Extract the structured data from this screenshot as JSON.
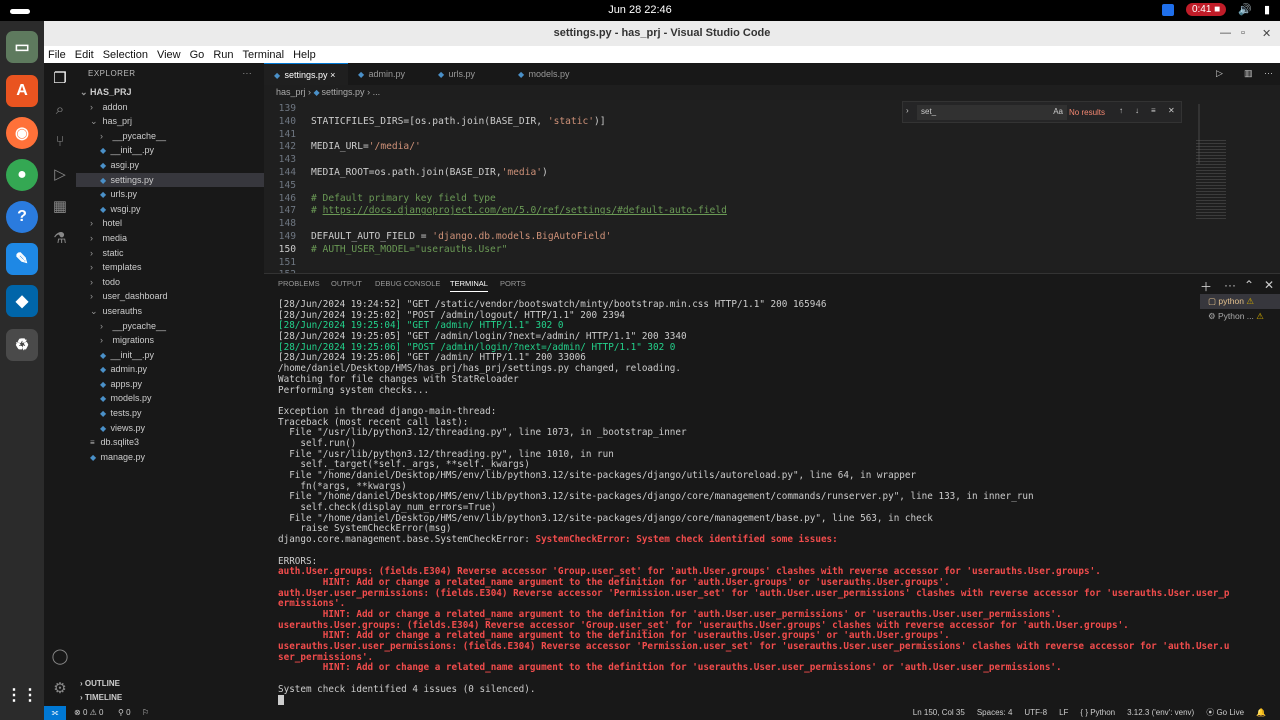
{
  "system": {
    "clock": "Jun 28  22:46",
    "record_time": "0:41"
  },
  "window": {
    "title": "settings.py - has_prj - Visual Studio Code"
  },
  "menu": [
    "File",
    "Edit",
    "Selection",
    "View",
    "Go",
    "Run",
    "Terminal",
    "Help"
  ],
  "explorer": {
    "header": "EXPLORER",
    "project": "HAS_PRJ",
    "items": [
      {
        "label": "addon",
        "type": "folder",
        "depth": 1
      },
      {
        "label": "has_prj",
        "type": "folder-open",
        "depth": 1
      },
      {
        "label": "__pycache__",
        "type": "folder",
        "depth": 2
      },
      {
        "label": "__init__.py",
        "type": "py",
        "depth": 2
      },
      {
        "label": "asgi.py",
        "type": "py",
        "depth": 2
      },
      {
        "label": "settings.py",
        "type": "py",
        "depth": 2,
        "selected": true
      },
      {
        "label": "urls.py",
        "type": "py",
        "depth": 2
      },
      {
        "label": "wsgi.py",
        "type": "py",
        "depth": 2
      },
      {
        "label": "hotel",
        "type": "folder",
        "depth": 1
      },
      {
        "label": "media",
        "type": "folder",
        "depth": 1
      },
      {
        "label": "static",
        "type": "folder",
        "depth": 1
      },
      {
        "label": "templates",
        "type": "folder",
        "depth": 1
      },
      {
        "label": "todo",
        "type": "folder",
        "depth": 1
      },
      {
        "label": "user_dashboard",
        "type": "folder",
        "depth": 1
      },
      {
        "label": "userauths",
        "type": "folder-open",
        "depth": 1
      },
      {
        "label": "__pycache__",
        "type": "folder",
        "depth": 2
      },
      {
        "label": "migrations",
        "type": "folder",
        "depth": 2
      },
      {
        "label": "__init__.py",
        "type": "py",
        "depth": 2
      },
      {
        "label": "admin.py",
        "type": "py",
        "depth": 2
      },
      {
        "label": "apps.py",
        "type": "py",
        "depth": 2
      },
      {
        "label": "models.py",
        "type": "py",
        "depth": 2
      },
      {
        "label": "tests.py",
        "type": "py",
        "depth": 2
      },
      {
        "label": "views.py",
        "type": "py",
        "depth": 2
      },
      {
        "label": "db.sqlite3",
        "type": "db",
        "depth": 1
      },
      {
        "label": "manage.py",
        "type": "py",
        "depth": 1
      }
    ],
    "outline": "OUTLINE",
    "timeline": "TIMELINE"
  },
  "tabs": [
    {
      "label": "settings.py",
      "active": true
    },
    {
      "label": "admin.py"
    },
    {
      "label": "urls.py"
    },
    {
      "label": "models.py"
    }
  ],
  "breadcrumb": [
    "has_prj",
    "settings.py",
    "..."
  ],
  "editor_lines": [
    {
      "n": "139",
      "parts": []
    },
    {
      "n": "140",
      "parts": [
        [
          "p",
          "STATICFILES_DIRS=[os.path.join(BASE_DIR, "
        ],
        [
          "s",
          "'static'"
        ],
        [
          "p",
          ")]"
        ]
      ]
    },
    {
      "n": "141",
      "parts": []
    },
    {
      "n": "142",
      "parts": [
        [
          "p",
          "MEDIA_URL="
        ],
        [
          "s",
          "'/media/'"
        ]
      ]
    },
    {
      "n": "143",
      "parts": []
    },
    {
      "n": "144",
      "parts": [
        [
          "p",
          "MEDIA_ROOT=os.path.join(BASE_DIR,"
        ],
        [
          "s",
          "'media'"
        ],
        [
          "p",
          ")"
        ]
      ]
    },
    {
      "n": "145",
      "parts": []
    },
    {
      "n": "146",
      "parts": [
        [
          "c",
          "# Default primary key field type"
        ]
      ]
    },
    {
      "n": "147",
      "parts": [
        [
          "c",
          "# "
        ],
        [
          "u",
          "https://docs.djangoproject.com/en/5.0/ref/settings/#default-auto-field"
        ]
      ]
    },
    {
      "n": "148",
      "parts": []
    },
    {
      "n": "149",
      "parts": [
        [
          "p",
          "DEFAULT_AUTO_FIELD = "
        ],
        [
          "s",
          "'django.db.models.BigAutoField'"
        ]
      ]
    },
    {
      "n": "150",
      "parts": [
        [
          "c",
          "# AUTH_USER_MODEL=\"userauths.User\""
        ]
      ]
    },
    {
      "n": "151",
      "parts": []
    },
    {
      "n": "152",
      "parts": []
    }
  ],
  "find": {
    "value": "set_",
    "result": "No results",
    "options": "Aa"
  },
  "panel_tabs": [
    "PROBLEMS",
    "OUTPUT",
    "DEBUG CONSOLE",
    "TERMINAL",
    "PORTS"
  ],
  "terminal_lines": [
    {
      "t": "[28/Jun/2024 19:24:52] \"GET /static/vendor/bootswatch/minty/bootstrap.min.css HTTP/1.1\" 200 165946",
      "k": ""
    },
    {
      "t": "[28/Jun/2024 19:25:02] \"POST /admin/logout/ HTTP/1.1\" 200 2394",
      "k": ""
    },
    {
      "t": "[28/Jun/2024 19:25:04] \"GET /admin/ HTTP/1.1\" 302 0",
      "k": "green"
    },
    {
      "t": "[28/Jun/2024 19:25:05] \"GET /admin/login/?next=/admin/ HTTP/1.1\" 200 3340",
      "k": ""
    },
    {
      "t": "[28/Jun/2024 19:25:06] \"POST /admin/login/?next=/admin/ HTTP/1.1\" 302 0",
      "k": "green"
    },
    {
      "t": "[28/Jun/2024 19:25:06] \"GET /admin/ HTTP/1.1\" 200 33006",
      "k": ""
    },
    {
      "t": "/home/daniel/Desktop/HMS/has_prj/has_prj/settings.py changed, reloading.",
      "k": ""
    },
    {
      "t": "Watching for file changes with StatReloader",
      "k": ""
    },
    {
      "t": "Performing system checks...",
      "k": ""
    },
    {
      "t": "",
      "k": ""
    },
    {
      "t": "Exception in thread django-main-thread:",
      "k": ""
    },
    {
      "t": "Traceback (most recent call last):",
      "k": ""
    },
    {
      "t": "  File \"/usr/lib/python3.12/threading.py\", line 1073, in _bootstrap_inner",
      "k": ""
    },
    {
      "t": "    self.run()",
      "k": ""
    },
    {
      "t": "  File \"/usr/lib/python3.12/threading.py\", line 1010, in run",
      "k": ""
    },
    {
      "t": "    self._target(*self._args, **self._kwargs)",
      "k": ""
    },
    {
      "t": "  File \"/home/daniel/Desktop/HMS/env/lib/python3.12/site-packages/django/utils/autoreload.py\", line 64, in wrapper",
      "k": ""
    },
    {
      "t": "    fn(*args, **kwargs)",
      "k": ""
    },
    {
      "t": "  File \"/home/daniel/Desktop/HMS/env/lib/python3.12/site-packages/django/core/management/commands/runserver.py\", line 133, in inner_run",
      "k": ""
    },
    {
      "t": "    self.check(display_num_errors=True)",
      "k": ""
    },
    {
      "t": "  File \"/home/daniel/Desktop/HMS/env/lib/python3.12/site-packages/django/core/management/base.py\", line 563, in check",
      "k": ""
    },
    {
      "t": "    raise SystemCheckError(msg)",
      "k": ""
    },
    {
      "t": "django.core.management.base.SystemCheckError: ",
      "k": "mixed",
      "red": "SystemCheckError: System check identified some issues:"
    },
    {
      "t": "",
      "k": ""
    },
    {
      "t": "ERRORS:",
      "k": ""
    },
    {
      "t": "auth.User.groups: (fields.E304) Reverse accessor 'Group.user_set' for 'auth.User.groups' clashes with reverse accessor for 'userauths.User.groups'.",
      "k": "red"
    },
    {
      "t": "        HINT: Add or change a related_name argument to the definition for 'auth.User.groups' or 'userauths.User.groups'.",
      "k": "red"
    },
    {
      "t": "auth.User.user_permissions: (fields.E304) Reverse accessor 'Permission.user_set' for 'auth.User.user_permissions' clashes with reverse accessor for 'userauths.User.user_p",
      "k": "red"
    },
    {
      "t": "ermissions'.",
      "k": "red"
    },
    {
      "t": "        HINT: Add or change a related_name argument to the definition for 'auth.User.user_permissions' or 'userauths.User.user_permissions'.",
      "k": "red"
    },
    {
      "t": "userauths.User.groups: (fields.E304) Reverse accessor 'Group.user_set' for 'userauths.User.groups' clashes with reverse accessor for 'auth.User.groups'.",
      "k": "red"
    },
    {
      "t": "        HINT: Add or change a related_name argument to the definition for 'userauths.User.groups' or 'auth.User.groups'.",
      "k": "red"
    },
    {
      "t": "userauths.User.user_permissions: (fields.E304) Reverse accessor 'Permission.user_set' for 'userauths.User.user_permissions' clashes with reverse accessor for 'auth.User.u",
      "k": "red"
    },
    {
      "t": "ser_permissions'.",
      "k": "red"
    },
    {
      "t": "        HINT: Add or change a related_name argument to the definition for 'userauths.User.user_permissions' or 'auth.User.user_permissions'.",
      "k": "red"
    },
    {
      "t": "",
      "k": ""
    },
    {
      "t": "System check identified 4 issues (0 silenced).",
      "k": ""
    }
  ],
  "terminal_list": [
    "python",
    "Python ..."
  ],
  "status": {
    "errors": "0",
    "warnings": "0",
    "ports": "0",
    "position": "Ln 150, Col 35",
    "spaces": "Spaces: 4",
    "encoding": "UTF-8",
    "eol": "LF",
    "language": "Python",
    "interpreter": "3.12.3 ('env': venv)",
    "golive": "Go Live"
  },
  "colors": {
    "accent": "#0078d4",
    "error": "#f14c4c",
    "ok": "#23d18b",
    "dock": "#2b2b2b"
  }
}
